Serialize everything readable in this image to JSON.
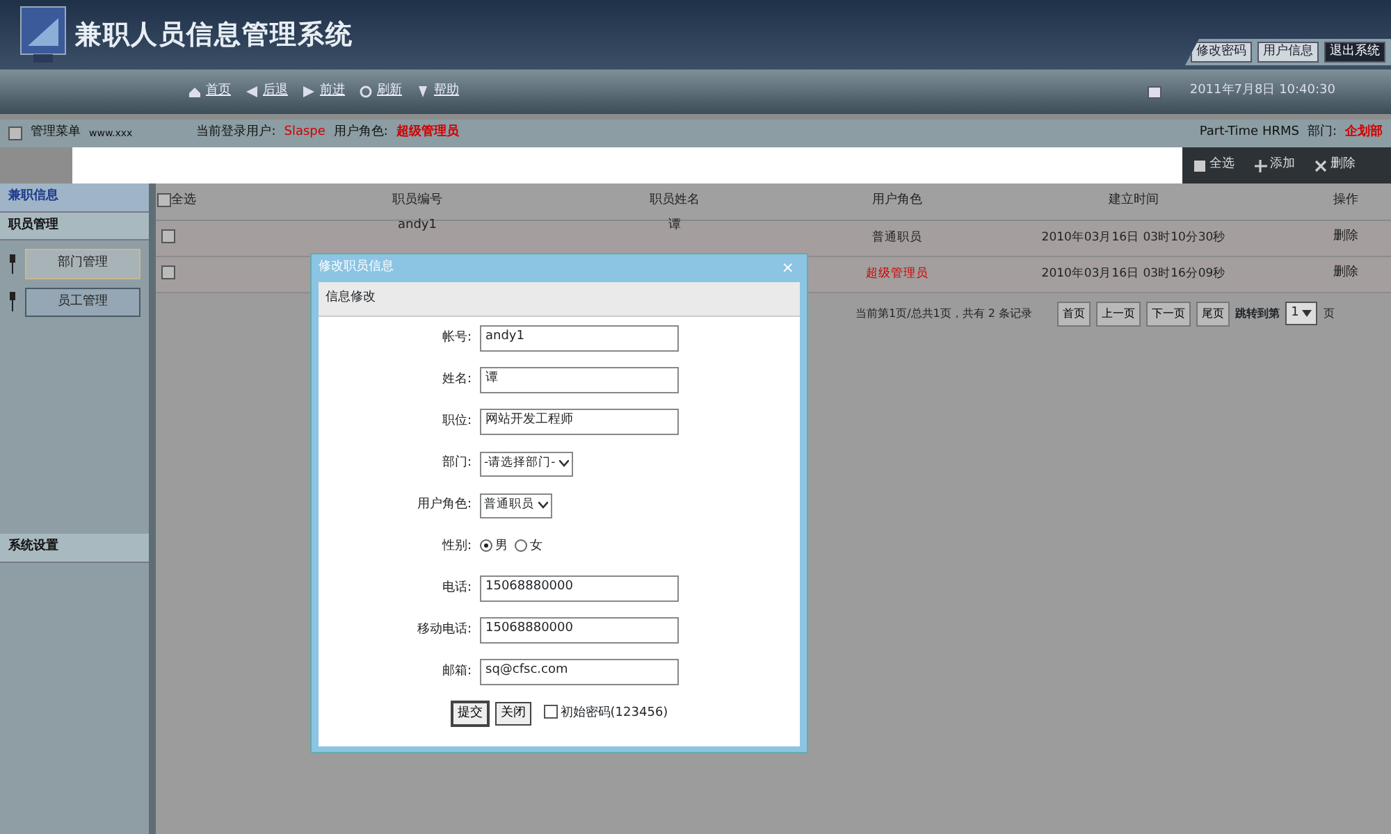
{
  "header": {
    "title": "兼职人员信息管理系统",
    "top_buttons": [
      {
        "label": "修改密码",
        "kind": "key"
      },
      {
        "label": "用户信息",
        "kind": "user"
      },
      {
        "label": "退出系统",
        "kind": "exit"
      }
    ],
    "nav": [
      {
        "label": "首页",
        "kind": "home"
      },
      {
        "label": "后退",
        "kind": "back"
      },
      {
        "label": "前进",
        "kind": "forward"
      },
      {
        "label": "刷新",
        "kind": "refresh"
      },
      {
        "label": "帮助",
        "kind": "help"
      }
    ],
    "datetime": "2011年7月8日 10:40:30"
  },
  "info_bar": {
    "menu_checked": false,
    "menu_title": "管理菜单",
    "menu_note": "www.xxx",
    "user_label": "当前登录用户:",
    "user": "Slaspe",
    "role_label": "用户角色:",
    "role": "超级管理员",
    "system": "Part-Time HRMS",
    "dept_label": "部门:",
    "dept": "企划部"
  },
  "sidebar": {
    "sections": [
      {
        "label": "兼职信息",
        "selected": true
      },
      {
        "label": "职员管理",
        "selected": false,
        "items": [
          {
            "label": "部门管理",
            "selected": false
          },
          {
            "label": "员工管理",
            "selected": true
          }
        ]
      },
      {
        "label": "系统设置",
        "selected": false
      }
    ]
  },
  "toolbar": [
    {
      "label": "全选",
      "kind": "check"
    },
    {
      "label": "添加",
      "kind": "add"
    },
    {
      "label": "删除",
      "kind": "delete"
    }
  ],
  "table": {
    "select_all": "全选",
    "select_all_checked": false,
    "columns": [
      "职员编号",
      "职员姓名",
      "用户角色",
      "建立时间",
      "操作"
    ],
    "rows": [
      {
        "checked": false,
        "id": "andy1",
        "name": "谭",
        "role": "普通职员",
        "admin": false,
        "created": "2010年03月16日 03时10分30秒",
        "action": "删除"
      },
      {
        "checked": false,
        "role": "超级管理员",
        "admin": true,
        "created": "2010年03月16日 03时16分09秒",
        "action": "删除"
      }
    ]
  },
  "pagination": {
    "summary": "当前第1页/总共1页，共有 2 条记录",
    "buttons": [
      "首页",
      "上一页",
      "下一页",
      "尾页"
    ],
    "jump_label": "跳转到第",
    "page": "1",
    "suffix": "页"
  },
  "dialog": {
    "title": "修改职员信息",
    "close": "×",
    "section": "信息修改",
    "fields": [
      {
        "label": "帐号:",
        "kind": "text",
        "value": "andy1"
      },
      {
        "label": "姓名:",
        "kind": "text",
        "value": "谭"
      },
      {
        "label": "职位:",
        "kind": "text",
        "value": "网站开发工程师"
      },
      {
        "label": "部门:",
        "kind": "select",
        "value": "-请选择部门-"
      },
      {
        "label": "用户角色:",
        "kind": "select",
        "value": "普通职员"
      },
      {
        "label": "性别:",
        "kind": "radio",
        "options": [
          {
            "label": "男",
            "selected": true
          },
          {
            "label": "女",
            "selected": false
          }
        ]
      },
      {
        "label": "电话:",
        "kind": "text",
        "value": "15068880000"
      },
      {
        "label": "移动电话:",
        "kind": "text",
        "value": "15068880000"
      },
      {
        "label": "邮箱:",
        "kind": "text",
        "value": "sq@cfsc.com"
      }
    ],
    "buttons": [
      "提交",
      "关闭"
    ],
    "reset_password": {
      "label": "初始密码(123456)",
      "checked": false
    }
  }
}
